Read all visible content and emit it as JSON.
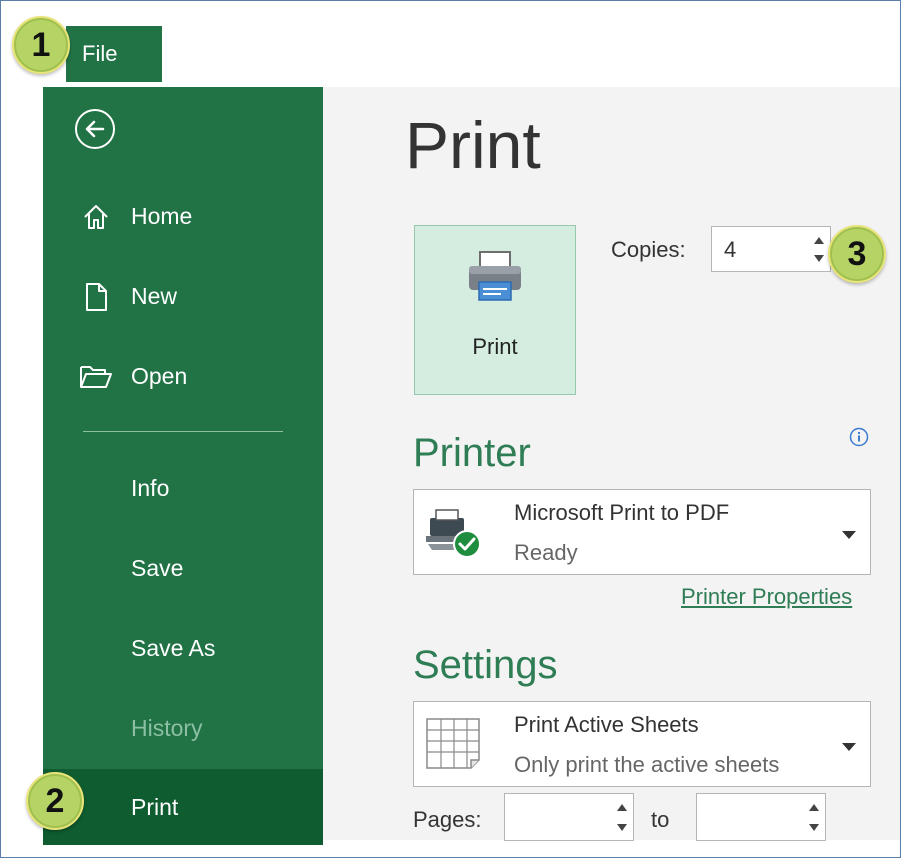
{
  "file_tab": {
    "label": "File"
  },
  "sidebar": {
    "items": [
      {
        "label": "Home",
        "icon": "home-icon"
      },
      {
        "label": "New",
        "icon": "new-document-icon"
      },
      {
        "label": "Open",
        "icon": "open-folder-icon"
      },
      {
        "label": "Info"
      },
      {
        "label": "Save"
      },
      {
        "label": "Save As"
      },
      {
        "label": "History",
        "state": "disabled"
      },
      {
        "label": "Print",
        "state": "selected"
      }
    ]
  },
  "badges": [
    "1",
    "2",
    "3"
  ],
  "main": {
    "title": "Print",
    "print_button": {
      "label": "Print"
    },
    "copies": {
      "label": "Copies:",
      "value": "4"
    },
    "printer": {
      "heading": "Printer",
      "name": "Microsoft Print to PDF",
      "status": "Ready",
      "properties_link": "Printer Properties"
    },
    "settings": {
      "heading": "Settings",
      "scope_title": "Print Active Sheets",
      "scope_description": "Only print the active sheets",
      "pages_label": "Pages:",
      "to_label": "to"
    }
  },
  "colors": {
    "sidebar_bg": "#217346",
    "sidebar_selected": "#0e5c2f",
    "accent_green": "#2e7d55",
    "print_button_bg": "#d4ede0",
    "badge_fill": "#b6d465"
  }
}
